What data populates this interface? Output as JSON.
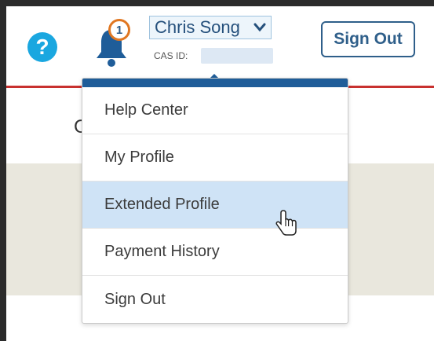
{
  "header": {
    "help_icon_glyph": "?",
    "notification_count": "1",
    "user_name": "Chris Song",
    "cas_id_label": "CAS ID:",
    "sign_out_label": "Sign Out"
  },
  "page": {
    "cut_heading_letter": "C"
  },
  "dropdown": {
    "items": [
      {
        "label": "Help Center"
      },
      {
        "label": "My Profile"
      },
      {
        "label": "Extended Profile"
      },
      {
        "label": "Payment History"
      },
      {
        "label": "Sign Out"
      }
    ],
    "hovered_item": "Extended Profile"
  },
  "colors": {
    "brand_blue": "#1f5d99",
    "accent_red": "#c8312f",
    "badge_orange": "#e07722",
    "help_blue": "#1aa7e0",
    "hover_bg": "#cfe3f6"
  },
  "icons": {
    "help": "question-icon",
    "notifications": "bell-icon",
    "dropdown": "chevron-down-icon",
    "cursor": "hand-pointer-icon"
  }
}
